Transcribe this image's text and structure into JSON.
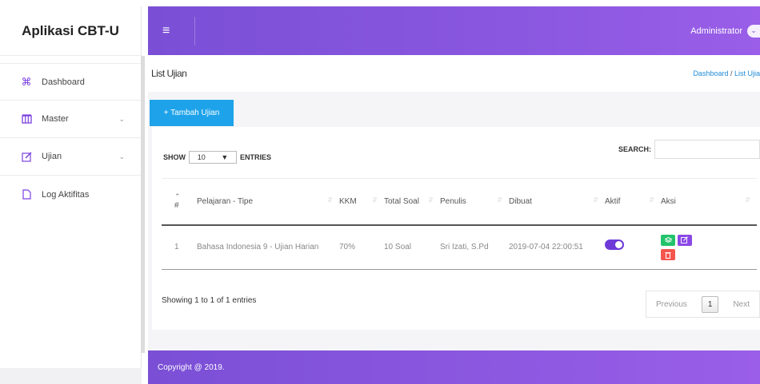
{
  "app": {
    "title": "Aplikasi CBT-U"
  },
  "sidebar": {
    "items": [
      {
        "label": "Dashboard",
        "icon": "command-icon",
        "chevron": ""
      },
      {
        "label": "Master",
        "icon": "columns-icon",
        "chevron": "⌄"
      },
      {
        "label": "Ujian",
        "icon": "edit-icon",
        "chevron": "⌄"
      },
      {
        "label": "Log Aktifitas",
        "icon": "file-icon",
        "chevron": ""
      }
    ]
  },
  "header": {
    "menu_icon": "≡",
    "user": "Administrator",
    "user_chevron": "⌄"
  },
  "page": {
    "title": "List Ujian",
    "breadcrumb_home": "Dashboard",
    "breadcrumb_sep": " / ",
    "breadcrumb_current": "List Ujia"
  },
  "toolbar": {
    "add_label": "+ Tambah Ujian"
  },
  "table_controls": {
    "show_label": "SHOW",
    "entries_value": "10",
    "entries_label": "ENTRIES",
    "search_label": "SEARCH:"
  },
  "table": {
    "columns": [
      "#",
      "Pelajaran - Tipe",
      "KKM",
      "Total Soal",
      "Penulis",
      "Dibuat",
      "Aktif",
      "Aksi"
    ],
    "rows": [
      {
        "no": "1",
        "pelajaran": "Bahasa Indonesia 9 - Ujian Harian",
        "kkm": "70%",
        "total_soal": "10 Soal",
        "penulis": "Sri Izati, S.Pd",
        "dibuat": "2019-07-04 22:00:51",
        "aktif": true
      }
    ]
  },
  "pagination": {
    "info": "Showing 1 to 1 of 1 entries",
    "previous": "Previous",
    "current": "1",
    "next": "Next"
  },
  "footer": {
    "text": "Copyright @ 2019."
  },
  "colors": {
    "accent": "#7a4fd6",
    "primary_button": "#1ea3ea",
    "green": "#23c36b",
    "red": "#f2564f"
  }
}
